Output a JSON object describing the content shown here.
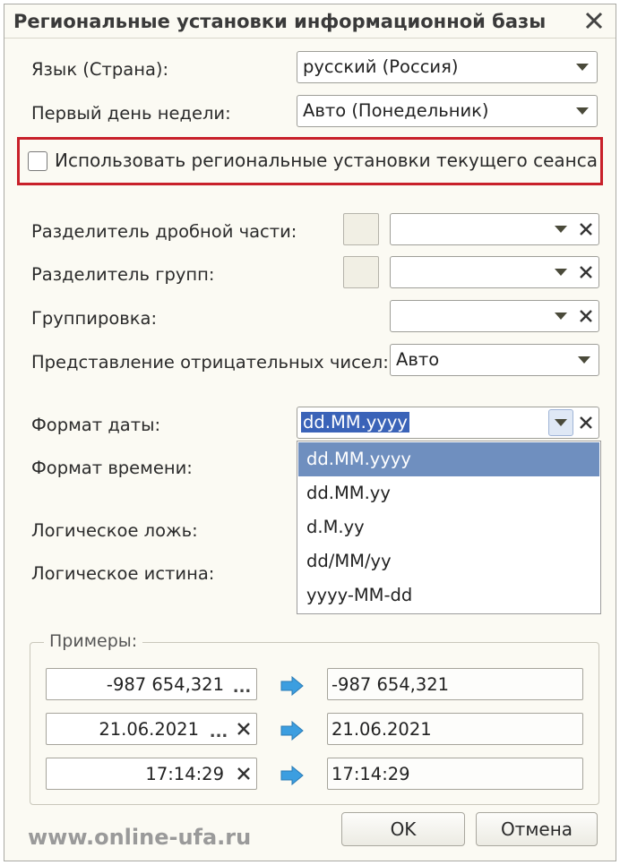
{
  "window": {
    "title": "Региональные установки информационной базы"
  },
  "fields": {
    "language": {
      "label": "Язык (Страна):",
      "value": "русский (Россия)"
    },
    "first_day": {
      "label": "Первый день недели:",
      "value": "Авто (Понедельник)"
    },
    "use_session": {
      "label": "Использовать региональные установки текущего сеанса",
      "checked": false
    },
    "decimal_sep": {
      "label": "Разделитель дробной части:",
      "value": ""
    },
    "group_sep": {
      "label": "Разделитель групп:",
      "value": ""
    },
    "grouping": {
      "label": "Группировка:",
      "value": ""
    },
    "negative": {
      "label": "Представление отрицательных чисел:",
      "value": "Авто"
    },
    "date_format": {
      "label": "Формат даты:",
      "value": "dd.MM.yyyy"
    },
    "time_format": {
      "label": "Формат времени:"
    },
    "bool_false": {
      "label": "Логическое ложь:"
    },
    "bool_true": {
      "label": "Логическое истина:"
    }
  },
  "date_format_options": [
    "dd.MM.yyyy",
    "dd.MM.yy",
    "d.M.yy",
    "dd/MM/yy",
    "yyyy-MM-dd"
  ],
  "examples": {
    "title": "Примеры:",
    "rows": [
      {
        "input": "-987 654,321",
        "result": "-987 654,321",
        "dots": "...",
        "has_clear": false
      },
      {
        "input": "21.06.2021",
        "result": "21.06.2021",
        "dots": "...",
        "has_clear": true
      },
      {
        "input": "17:14:29",
        "result": "17:14:29",
        "has_clear": true
      }
    ]
  },
  "buttons": {
    "ok": "OK",
    "cancel": "Отмена"
  },
  "watermark": "www.online-ufa.ru",
  "colors": {
    "highlight": "#6f8fbf",
    "red_frame": "#c8202a",
    "arrow": "#3c9ee0"
  }
}
